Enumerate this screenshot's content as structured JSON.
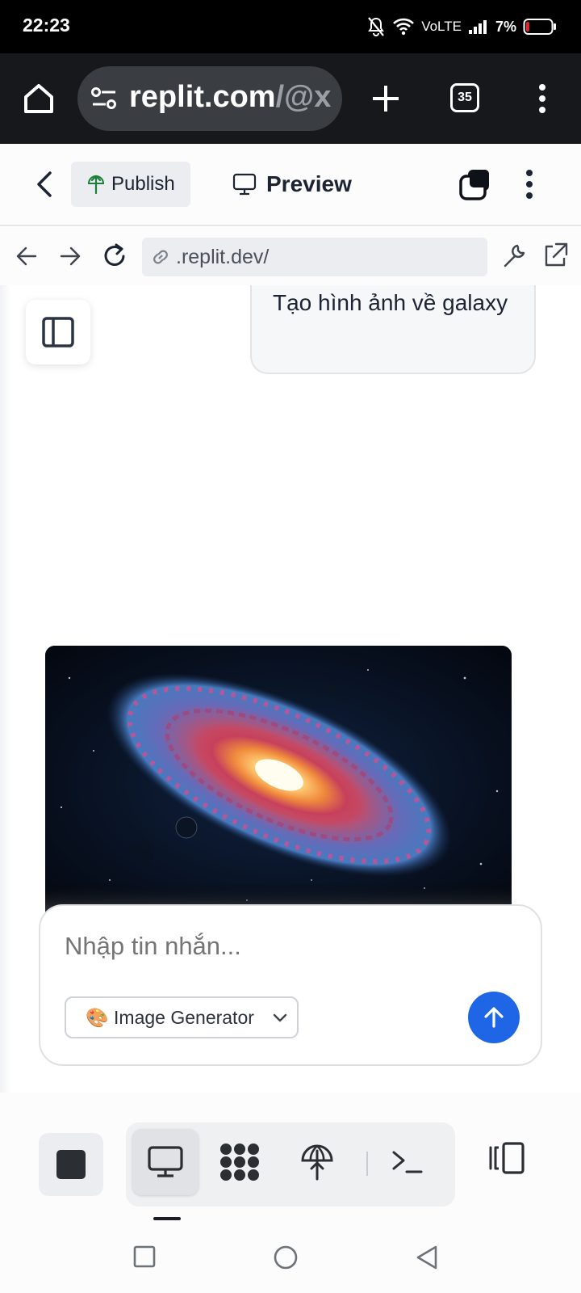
{
  "status_bar": {
    "time": "22:23",
    "network": "VoLTE",
    "battery": "7%"
  },
  "browser": {
    "url_main": "replit.com",
    "url_rest": "/@x",
    "tab_count": "35"
  },
  "replit_bar": {
    "publish_label": "Publish",
    "preview_label": "Preview"
  },
  "webview": {
    "address": ".replit.dev/"
  },
  "chat": {
    "user_message": "Tạo hình ảnh về galaxy",
    "input_placeholder": "Nhập tin nhắn...",
    "model_selected": "🎨 Image Generator"
  },
  "colors": {
    "accent": "#1e66e6",
    "publish_icon": "#1a7f37",
    "battery_low": "#e0262b"
  },
  "icons": {
    "browser": [
      "home-icon",
      "tune-icon",
      "plus-icon",
      "tabs-icon",
      "more-vertical-icon"
    ],
    "dock": [
      "stop-icon",
      "monitor-icon",
      "workflows-icon",
      "deploy-icon",
      "terminal-icon",
      "layout-icon"
    ]
  }
}
